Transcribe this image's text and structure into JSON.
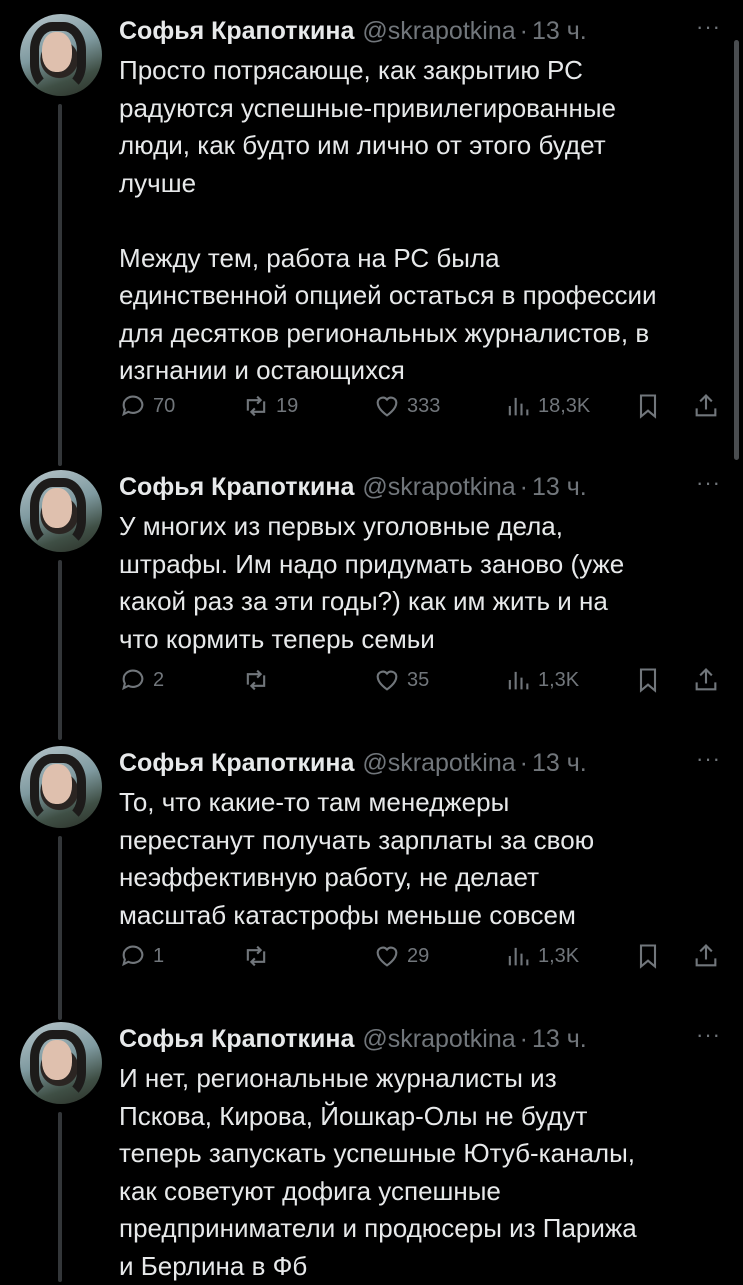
{
  "tweets": [
    {
      "name": "Софья Крапоткина",
      "handle": "@skrapotkina",
      "separator": "·",
      "time": "13 ч.",
      "more": "···",
      "text": "Просто потрясающе, как закрытию РС\nрадуются успешные-привилегированные\nлюди, как будто им лично от этого будет\nлучше\n\nМежду тем, работа на РС была\nединственной опцией остаться в профессии\nдля десятков региональных журналистов, в\nизгнании и остающихся",
      "replies": "70",
      "reposts": "19",
      "likes": "333",
      "views": "18,3K"
    },
    {
      "name": "Софья Крапоткина",
      "handle": "@skrapotkina",
      "separator": "·",
      "time": "13 ч.",
      "more": "···",
      "text": "У многих из первых уголовные дела,\nштрафы. Им надо придумать заново (уже\nкакой раз за эти годы?) как им жить и на\nчто кормить теперь семьи",
      "replies": "2",
      "reposts": "",
      "likes": "35",
      "views": "1,3K"
    },
    {
      "name": "Софья Крапоткина",
      "handle": "@skrapotkina",
      "separator": "·",
      "time": "13 ч.",
      "more": "···",
      "text": "То, что какие-то там менеджеры\nперестанут получать зарплаты за свою\nнеэффективную работу, не делает\nмасштаб катастрофы меньше совсем",
      "replies": "1",
      "reposts": "",
      "likes": "29",
      "views": "1,3K"
    },
    {
      "name": "Софья Крапоткина",
      "handle": "@skrapotkina",
      "separator": "·",
      "time": "13 ч.",
      "more": "···",
      "text": "И нет, региональные журналисты из\nПскова, Кирова, Йошкар-Олы не будут\nтеперь запускать успешные Ютуб-каналы,\nкак советуют дофига успешные\nпредприниматели и продюсеры из Парижа\nи Берлина в Фб"
    }
  ],
  "icons": {
    "reply": "reply-icon",
    "repost": "repost-icon",
    "like": "heart-icon",
    "views": "views-icon",
    "bookmark": "bookmark-icon",
    "share": "share-icon"
  },
  "colors": {
    "background": "#000000",
    "text": "#e7e9ea",
    "muted": "#71767b",
    "thread_line": "#333639"
  }
}
